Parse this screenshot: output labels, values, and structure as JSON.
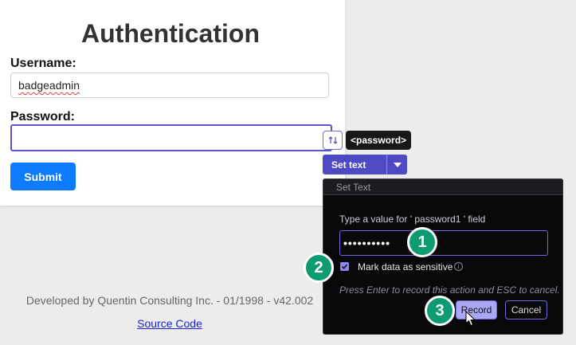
{
  "auth": {
    "title": "Authentication",
    "username_label": "Username:",
    "username_value": "badgeadmin",
    "password_label": "Password:",
    "password_value": "",
    "submit_label": "Submit"
  },
  "footer": {
    "text": "Developed by Quentin Consulting Inc. - 01/1998 - v42.002",
    "link": "Source Code"
  },
  "recorder": {
    "field_tag": "<password>",
    "set_text_label": "Set text",
    "panel_title": "Set Text",
    "prompt": "Type a value for ' password1 ' field",
    "masked_value": "••••••••••",
    "sensitive_label": "Mark data as sensitive",
    "sensitive_checked": true,
    "hint": "Press Enter to record this action and ESC to cancel.",
    "record_label": "Record",
    "cancel_label": "Cancel",
    "accent_color": "#4e4ac4"
  },
  "steps": [
    "1",
    "2",
    "3"
  ],
  "colors": {
    "step_badge": "#0e9a72",
    "submit": "#0d7bff",
    "link": "#1a25d9"
  }
}
